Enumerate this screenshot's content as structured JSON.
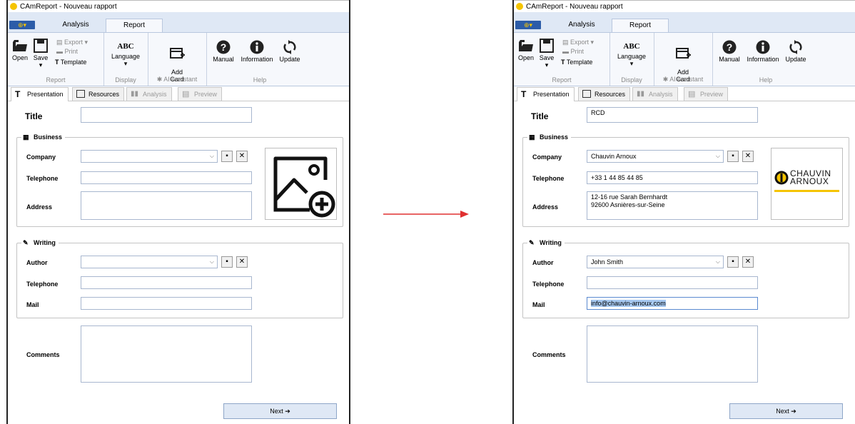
{
  "app": {
    "title": "CAmReport - Nouveau rapport",
    "menu_tabs": [
      "Analysis",
      "Report"
    ]
  },
  "ribbon": {
    "open": "Open",
    "save": "Save",
    "export": "Export",
    "print": "Print",
    "template": "Template",
    "report_group": "Report",
    "language_abc": "ABC",
    "language": "Language",
    "display_group": "Display",
    "add_card": "Add\nCard",
    "ai_assistant": "AI Assistant",
    "manual": "Manual",
    "information": "Information",
    "update": "Update",
    "help_group": "Help"
  },
  "doc_tabs": [
    "Presentation",
    "Resources",
    "Analysis",
    "Preview"
  ],
  "form": {
    "title_label": "Title",
    "business_label": "Business",
    "company_label": "Company",
    "telephone_label": "Telephone",
    "address_label": "Address",
    "writing_label": "Writing",
    "author_label": "Author",
    "mail_label": "Mail",
    "comments_label": "Comments",
    "next_button": "Next ➔"
  },
  "before": {
    "title": "",
    "company": "",
    "business_telephone": "",
    "address": "",
    "author": "",
    "writing_telephone": "",
    "mail": "",
    "comments": ""
  },
  "after": {
    "title": "RCD",
    "company": "Chauvin Arnoux",
    "business_telephone": "+33 1 44 85 44 85",
    "address": "12-16 rue Sarah Bernhardt\n92600 Asnières-sur-Seine",
    "author": "John Smith",
    "writing_telephone": "",
    "mail": "info@chauvin-arnoux.com",
    "comments": "",
    "logo_line1": "CHAUVIN",
    "logo_line2": "ARNOUX"
  },
  "colors": {
    "ribbon_bg": "#dfe8f5",
    "arrow": "#e03030",
    "logo_yellow": "#f5c400",
    "selection": "#a6c8f0"
  }
}
